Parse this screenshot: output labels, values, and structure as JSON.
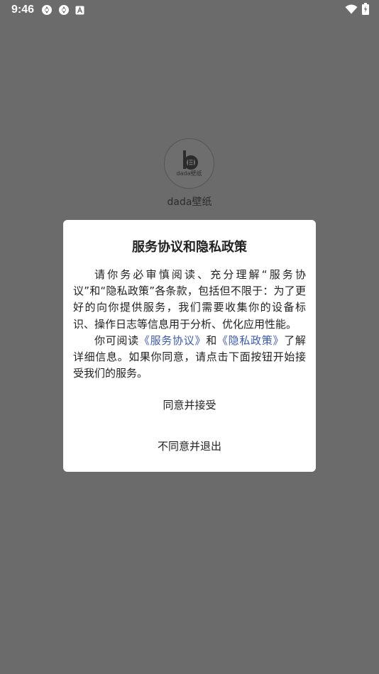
{
  "status_bar": {
    "time": "9:46",
    "notification_icons": [
      "aperture-icon",
      "aperture-icon",
      "text-a-icon"
    ],
    "system_icons": [
      "wifi-icon",
      "battery-charging-icon"
    ]
  },
  "app": {
    "logo_text": "dada壁纸",
    "name": "dada壁纸"
  },
  "dialog": {
    "title": "服务协议和隐私政策",
    "para1": "请你务必审慎阅读、充分理解“服务协议”和“隐私政策”各条款，包括但不限于：为了更好的向你提供服务，我们需要收集你的设备标识、操作日志等信息用于分析、优化应用性能。",
    "para2_prefix": "你可阅读",
    "link_service": "《服务协议》",
    "para2_and": "和",
    "link_privacy": "《隐私政策》",
    "para2_suffix": "了解详细信息。如果你同意，请点击下面按钮开始接受我们的服务。",
    "agree_label": "同意并接受",
    "disagree_label": "不同意并退出",
    "link_color": "#3b5ab8"
  },
  "colors": {
    "overlay": "#6b6b6b",
    "dialog_bg": "#ffffff"
  }
}
